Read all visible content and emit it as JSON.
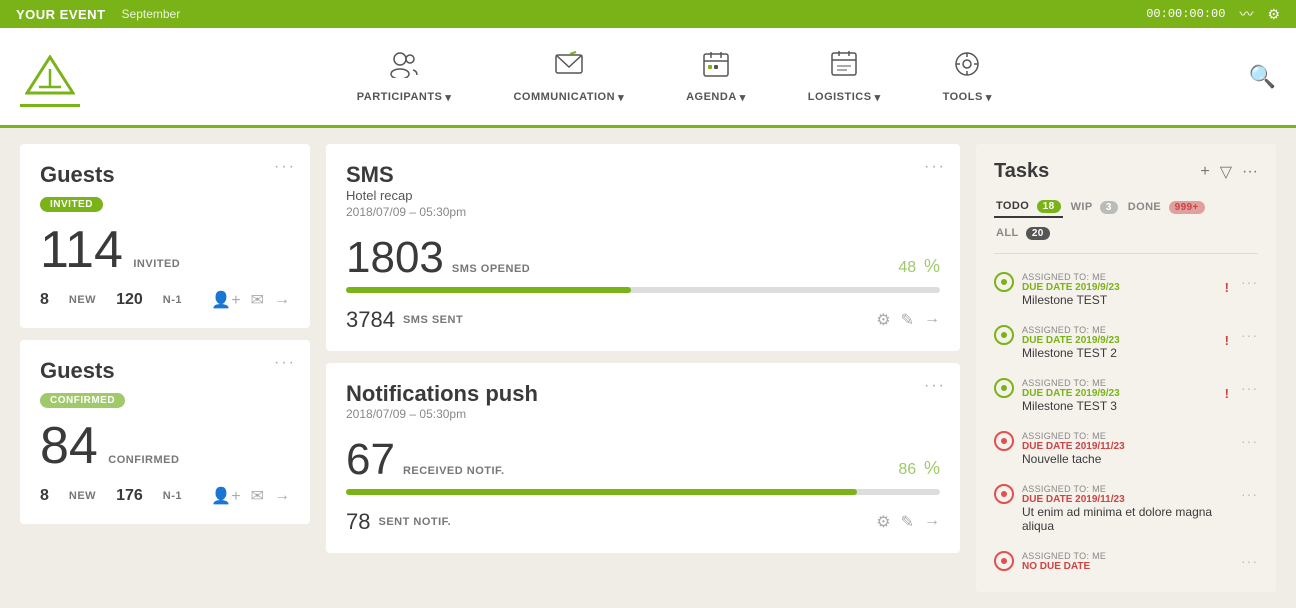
{
  "topbar": {
    "title": "YOUR EVENT",
    "subtitle": "September",
    "timer": "00:00:00:00"
  },
  "nav": {
    "logo_alt": "Event Logo",
    "items": [
      {
        "id": "participants",
        "label": "PARTICIPANTS",
        "icon": "👥"
      },
      {
        "id": "communication",
        "label": "COMMUNICATION",
        "icon": "✉"
      },
      {
        "id": "agenda",
        "label": "AGENDA",
        "icon": "📅"
      },
      {
        "id": "logistics",
        "label": "LOGISTICS",
        "icon": "🗓"
      },
      {
        "id": "tools",
        "label": "TOOLS",
        "icon": "⚙"
      }
    ]
  },
  "guests_invited": {
    "title": "Guests",
    "badge": "INVITED",
    "big_num": "114",
    "big_label": "INVITED",
    "new_num": "8",
    "new_label": "NEW",
    "n1_num": "120",
    "n1_label": "N-1"
  },
  "guests_confirmed": {
    "title": "Guests",
    "badge": "CONFIRMED",
    "big_num": "84",
    "big_label": "CONFIRMED",
    "new_num": "8",
    "new_label": "NEW",
    "n1_num": "176",
    "n1_label": "N-1"
  },
  "sms": {
    "title": "SMS",
    "subtitle": "Hotel recap",
    "date": "2018/07/09 – 05:30pm",
    "opened_num": "1803",
    "opened_label": "SMS OPENED",
    "opened_percent": "48",
    "progress": 48,
    "sent_num": "3784",
    "sent_label": "SMS SENT"
  },
  "notifications": {
    "title": "Notifications push",
    "date": "2018/07/09 – 05:30pm",
    "received_num": "67",
    "received_label": "RECEIVED NOTIF.",
    "received_percent": "86",
    "progress": 86,
    "sent_num": "78",
    "sent_label": "SENT NOTIF."
  },
  "tasks": {
    "title": "Tasks",
    "tabs": [
      {
        "id": "todo",
        "label": "TODO",
        "badge": "18",
        "badge_type": "green",
        "active": true
      },
      {
        "id": "wip",
        "label": "WIP",
        "badge": "3",
        "badge_type": "gray"
      },
      {
        "id": "done",
        "label": "DONE",
        "badge": "999+",
        "badge_type": "red"
      },
      {
        "id": "all",
        "label": "ALL",
        "badge": "20",
        "badge_type": "dark"
      }
    ],
    "items": [
      {
        "assigned": "ASSIGNED TO: ME",
        "due": "DUE DATE 2019/9/23",
        "due_type": "green",
        "name": "Milestone TEST",
        "has_exclaim": true
      },
      {
        "assigned": "ASSIGNED TO: ME",
        "due": "DUE DATE 2019/9/23",
        "due_type": "green",
        "name": "Milestone TEST 2",
        "has_exclaim": true
      },
      {
        "assigned": "ASSIGNED TO: ME",
        "due": "DUE DATE 2019/9/23",
        "due_type": "green",
        "name": "Milestone TEST 3",
        "has_exclaim": true
      },
      {
        "assigned": "ASSIGNED TO: ME",
        "due": "DUE DATE 2019/11/23",
        "due_type": "red",
        "name": "Nouvelle tache",
        "has_exclaim": false
      },
      {
        "assigned": "ASSIGNED TO: ME",
        "due": "DUE DATE 2019/11/23",
        "due_type": "red",
        "name": "Ut enim ad minima et dolore magna aliqua",
        "has_exclaim": false
      },
      {
        "assigned": "ASSIGNED TO: ME",
        "due": "NO DUE DATE",
        "due_type": "red",
        "name": "",
        "has_exclaim": false
      }
    ]
  },
  "labels": {
    "add": "+",
    "filter": "▽",
    "dots": "···",
    "chevron": "▾",
    "settings": "⚙",
    "edit": "✎",
    "arrow": "→",
    "person": "👤",
    "mail": "✉",
    "search": "🔍",
    "activity": "〰"
  }
}
